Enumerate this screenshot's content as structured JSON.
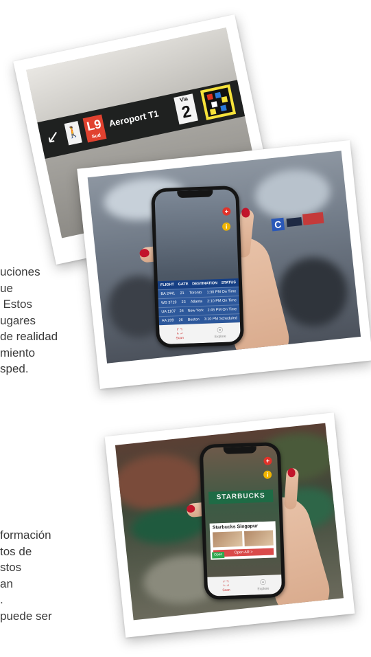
{
  "body_text": {
    "paragraph_1": [
      "uciones",
      "ue",
      ". Estos",
      "ugares",
      "de realidad",
      "miento",
      "sped."
    ],
    "paragraph_2": [
      "formación",
      "tos de",
      "stos",
      "an",
      ".",
      "puede ser"
    ]
  },
  "photo_1": {
    "sign": {
      "arrow": "↙",
      "walk_symbol": "🚶",
      "line_code": "L9",
      "line_sub": "Sud",
      "destination": "Aeroport T1",
      "via_label": "Via",
      "via_number": "2"
    },
    "marker_colors": [
      "#e1331f",
      "#2a78d8",
      "#f6e23a",
      "#ffffff"
    ]
  },
  "photo_2": {
    "gate_letter": "C",
    "badge_plus": "+",
    "badge_info": "i",
    "table_headers": [
      "FLIGHT",
      "GATE",
      "DESTINATION",
      "STATUS"
    ],
    "table_rows": [
      [
        "BA 2441",
        "21",
        "Toronto",
        "1:30 PM On Time"
      ],
      [
        "WS 3719",
        "23",
        "Atlanta",
        "2:10 PM On Time"
      ],
      [
        "UA 1107",
        "24",
        "New York",
        "2:45 PM On Time"
      ],
      [
        "AA 209",
        "26",
        "Boston",
        "3:10 PM Scheduled"
      ]
    ],
    "tab_scan": "Scan",
    "tab_explore": "Explore"
  },
  "photo_3": {
    "store_sign": "STARBUCKS",
    "badge_plus": "+",
    "badge_info": "i",
    "card_title": "Starbucks Singapur",
    "open_label": "Open",
    "card_button": "Open AR >",
    "tab_scan": "Scan",
    "tab_explore": "Explore"
  },
  "colors": {
    "accent_red": "#e0332a",
    "accent_yellow": "#f0b400",
    "nail_red": "#c2152b",
    "sign_dark": "#1f2120"
  }
}
